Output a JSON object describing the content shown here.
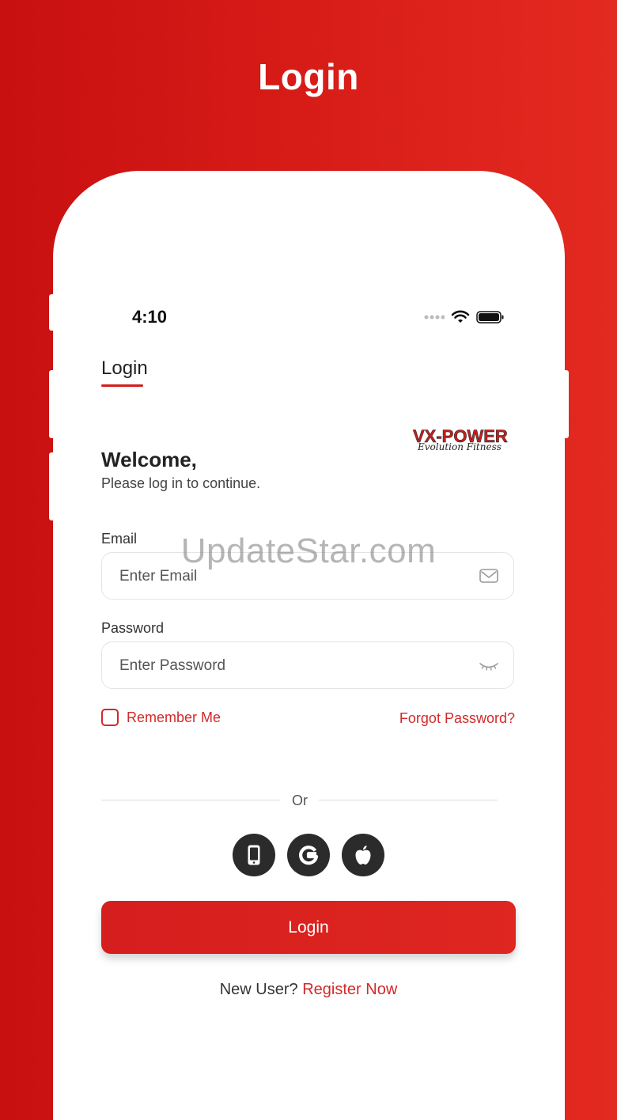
{
  "store_banner": {
    "title": "Login"
  },
  "status_bar": {
    "time": "4:10",
    "icons": [
      "signal-dots-icon",
      "wifi-icon",
      "battery-icon"
    ]
  },
  "tab": {
    "label": "Login"
  },
  "brand": {
    "logo_main": "VX-POWER",
    "logo_script": "Evolution Fitness"
  },
  "greeting": {
    "title": "Welcome,",
    "subtitle": "Please log in to continue."
  },
  "form": {
    "email": {
      "label": "Email",
      "placeholder": "Enter Email",
      "value": "",
      "icon": "mail-icon"
    },
    "password": {
      "label": "Password",
      "placeholder": "Enter Password",
      "value": "",
      "icon": "eye-closed-icon"
    },
    "remember_me": {
      "label": "Remember Me",
      "checked": false
    },
    "forgot_password": "Forgot Password?"
  },
  "divider_text": "Or",
  "social": [
    {
      "name": "phone-login-icon"
    },
    {
      "name": "google-icon"
    },
    {
      "name": "apple-icon"
    }
  ],
  "login_button": "Login",
  "register": {
    "prompt": "New User?",
    "link": "Register Now"
  },
  "watermark": "UpdateStar.com",
  "colors": {
    "accent": "#d21c1c",
    "background": "#d61b17",
    "icon_button": "#2b2b2b"
  }
}
